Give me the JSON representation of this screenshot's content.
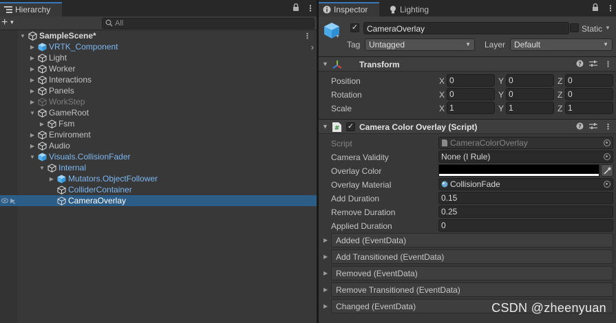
{
  "hierarchy": {
    "tab_label": "Hierarchy",
    "search_placeholder": "All",
    "rows": [
      {
        "label": "SampleScene*",
        "depth": 0,
        "arrow": "open",
        "icon": "unity-scene-icon",
        "style": "scene",
        "menu": true
      },
      {
        "label": "VRTK_Component",
        "depth": 1,
        "arrow": "closed",
        "icon": "prefab-cube-icon",
        "style": "prefab",
        "chevron": true
      },
      {
        "label": "Light",
        "depth": 1,
        "arrow": "closed",
        "icon": "cube-icon",
        "style": "normal"
      },
      {
        "label": "Worker",
        "depth": 1,
        "arrow": "closed",
        "icon": "cube-icon",
        "style": "normal"
      },
      {
        "label": "Interactions",
        "depth": 1,
        "arrow": "closed",
        "icon": "cube-icon",
        "style": "normal"
      },
      {
        "label": "Panels",
        "depth": 1,
        "arrow": "closed",
        "icon": "cube-icon",
        "style": "normal"
      },
      {
        "label": "WorkStep",
        "depth": 1,
        "arrow": "closed",
        "icon": "cube-icon",
        "style": "disabled"
      },
      {
        "label": "GameRoot",
        "depth": 1,
        "arrow": "open",
        "icon": "cube-icon",
        "style": "normal"
      },
      {
        "label": "Fsm",
        "depth": 2,
        "arrow": "closed",
        "icon": "cube-icon",
        "style": "normal"
      },
      {
        "label": "Enviroment",
        "depth": 1,
        "arrow": "closed",
        "icon": "cube-icon",
        "style": "normal"
      },
      {
        "label": "Audio",
        "depth": 1,
        "arrow": "closed",
        "icon": "cube-icon",
        "style": "normal"
      },
      {
        "label": "Visuals.CollisionFader",
        "depth": 1,
        "arrow": "open",
        "icon": "prefab-cube-icon",
        "style": "prefab"
      },
      {
        "label": "Internal",
        "depth": 2,
        "arrow": "open",
        "icon": "cube-icon",
        "style": "prefab"
      },
      {
        "label": "Mutators.ObjectFollower",
        "depth": 3,
        "arrow": "closed",
        "icon": "prefab-cube-icon",
        "style": "prefab"
      },
      {
        "label": "ColliderContainer",
        "depth": 3,
        "arrow": "none",
        "icon": "cube-icon",
        "style": "prefab"
      },
      {
        "label": "CameraOverlay",
        "depth": 3,
        "arrow": "none",
        "icon": "cube-icon",
        "style": "selected"
      }
    ]
  },
  "inspector": {
    "tabs": [
      {
        "label": "Inspector",
        "icon": "info-icon",
        "active": true
      },
      {
        "label": "Lighting",
        "icon": "lightbulb-icon",
        "active": false
      }
    ],
    "object_name": "CameraOverlay",
    "static_label": "Static",
    "tag_label": "Tag",
    "tag_value": "Untagged",
    "layer_label": "Layer",
    "layer_value": "Default",
    "transform": {
      "title": "Transform",
      "rows": [
        {
          "label": "Position",
          "x": "0",
          "y": "0",
          "z": "0"
        },
        {
          "label": "Rotation",
          "x": "0",
          "y": "0",
          "z": "0"
        },
        {
          "label": "Scale",
          "x": "1",
          "y": "1",
          "z": "1"
        }
      ],
      "axes": [
        "X",
        "Y",
        "Z"
      ]
    },
    "script_component": {
      "title": "Camera Color Overlay (Script)",
      "script_label": "Script",
      "script_value": "CameraColorOverlay",
      "camera_validity_label": "Camera Validity",
      "camera_validity_value": "None (I Rule)",
      "overlay_color_label": "Overlay Color",
      "overlay_color": "#000000",
      "overlay_material_label": "Overlay Material",
      "overlay_material_value": "CollisionFade",
      "add_duration_label": "Add Duration",
      "add_duration_value": "0.15",
      "remove_duration_label": "Remove Duration",
      "remove_duration_value": "0.25",
      "applied_duration_label": "Applied Duration",
      "applied_duration_value": "0",
      "events": [
        "Added (EventData)",
        "Add Transitioned (EventData)",
        "Removed (EventData)",
        "Remove Transitioned (EventData)",
        "Changed (EventData)"
      ]
    }
  },
  "watermark": "CSDN @zheenyuan",
  "colors": {
    "selection": "#2c5d87",
    "prefab_text": "#7cb8f2",
    "tab_accent": "#3a79bb"
  }
}
